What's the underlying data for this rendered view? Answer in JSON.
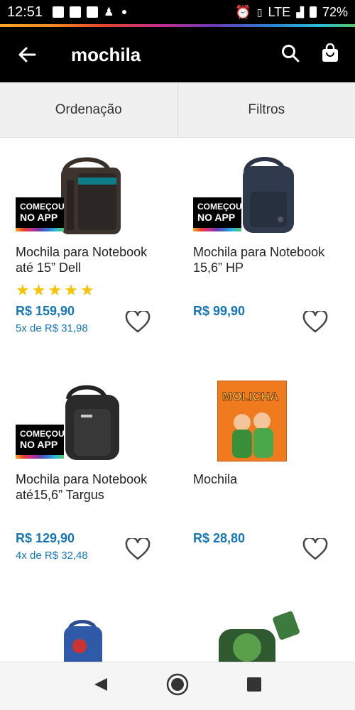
{
  "status_bar": {
    "time": "12:51",
    "network": "LTE",
    "battery": "72%"
  },
  "app_bar": {
    "title": "mochila",
    "icons": [
      "back-arrow-icon",
      "search-icon",
      "shopping-bag-icon"
    ]
  },
  "sort_bar": {
    "sort_label": "Ordenação",
    "filter_label": "Filtros"
  },
  "badge": {
    "line1": "COMEÇOU",
    "line2": "NO APP"
  },
  "products": [
    {
      "name_line1": "Mochila para Notebook",
      "name_line2": "até 15” Dell",
      "rating_stars": 5,
      "price": "R$ 159,90",
      "installments": "5x de R$ 31,98",
      "badge": true
    },
    {
      "name_line1": "Mochila para Notebook",
      "name_line2": "15,6” HP",
      "price": "R$ 99,90",
      "installments": "",
      "badge": true
    },
    {
      "name_line1": "Mochila para Notebook",
      "name_line2": "até15,6” Targus",
      "price": "R$ 129,90",
      "installments": "4x de R$ 32,48",
      "badge": true
    },
    {
      "name_line1": "Mochila",
      "name_line2": "",
      "price": "R$ 28,80",
      "installments": "",
      "badge": false,
      "book_cover_title": "MOLICHA"
    }
  ],
  "colors": {
    "price_blue": "#1577b8",
    "star_yellow": "#f6c300",
    "app_bar_bg": "#000000"
  }
}
